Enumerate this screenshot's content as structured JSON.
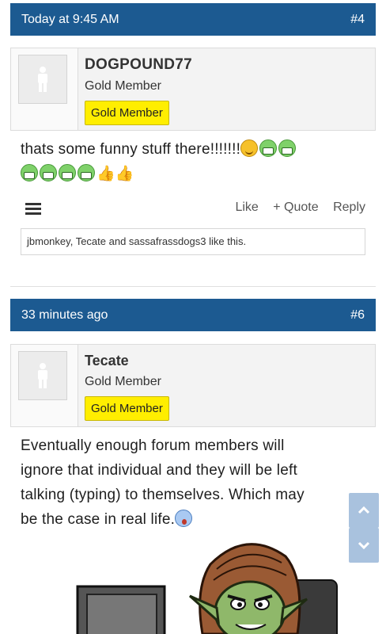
{
  "posts": [
    {
      "time": "Today at 9:45 AM",
      "number": "#4",
      "username": "DOGPOUND77",
      "user_title": "Gold Member",
      "badge": "Gold Member",
      "message": "thats some funny stuff there!!!!!!!"
    },
    {
      "time": "33 minutes ago",
      "number": "#6",
      "username": "Tecate",
      "user_title": "Gold Member",
      "badge": "Gold Member",
      "message_lines": [
        "Eventually enough forum members will",
        "ignore that individual and they will be left",
        "talking (typing) to themselves. Which may",
        "be the case in real life."
      ]
    }
  ],
  "actions": {
    "like": "Like",
    "quote": "+ Quote",
    "reply": "Reply"
  },
  "likes": {
    "user1": "jbmonkey",
    "sep1": ", ",
    "user2": "Tecate",
    "and": " and ",
    "user3": "sassafrassdogs3",
    "suffix": " like this."
  },
  "colors": {
    "header": "#1c5a91",
    "badge": "#ffee00",
    "scroll": "#a9c2de"
  }
}
